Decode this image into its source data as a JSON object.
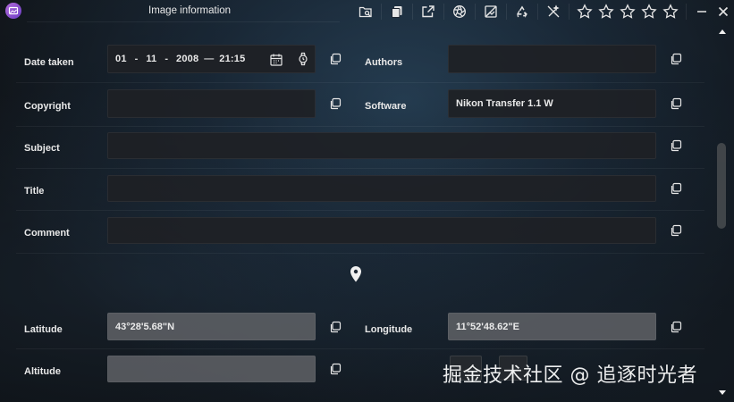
{
  "window": {
    "title": "Image information"
  },
  "toolbar": {
    "icons": [
      "folder-search-icon",
      "copy-pages-icon",
      "open-external-icon",
      "aperture-icon",
      "no-image-icon",
      "recycle-icon",
      "magic-wand-off-icon"
    ],
    "rating": {
      "max": 5,
      "value": 0
    },
    "window_controls": [
      "minimize-icon",
      "close-icon"
    ]
  },
  "fields": {
    "date_taken": {
      "label": "Date taken",
      "day": "01",
      "month": "11",
      "year": "2008",
      "dash": "-",
      "dash2": "-",
      "emdash": "—",
      "time": "21:15"
    },
    "authors": {
      "label": "Authors",
      "value": ""
    },
    "copyright": {
      "label": "Copyright",
      "value": ""
    },
    "software": {
      "label": "Software",
      "value": "Nikon Transfer 1.1 W"
    },
    "subject": {
      "label": "Subject",
      "value": ""
    },
    "title": {
      "label": "Title",
      "value": ""
    },
    "comment": {
      "label": "Comment",
      "value": ""
    },
    "latitude": {
      "label": "Latitude",
      "value": "43°28'5.68\"N"
    },
    "longitude": {
      "label": "Longitude",
      "value": "11°52'48.62\"E"
    },
    "altitude": {
      "label": "Altitude",
      "value": ""
    }
  },
  "watermark": "掘金技术社区 @ 追逐时光者",
  "colors": {
    "accent": "#8e4fd0",
    "field_bg": "#1e2125",
    "disabled_field_bg": "#5f6266",
    "text": "#e8e8e8"
  }
}
